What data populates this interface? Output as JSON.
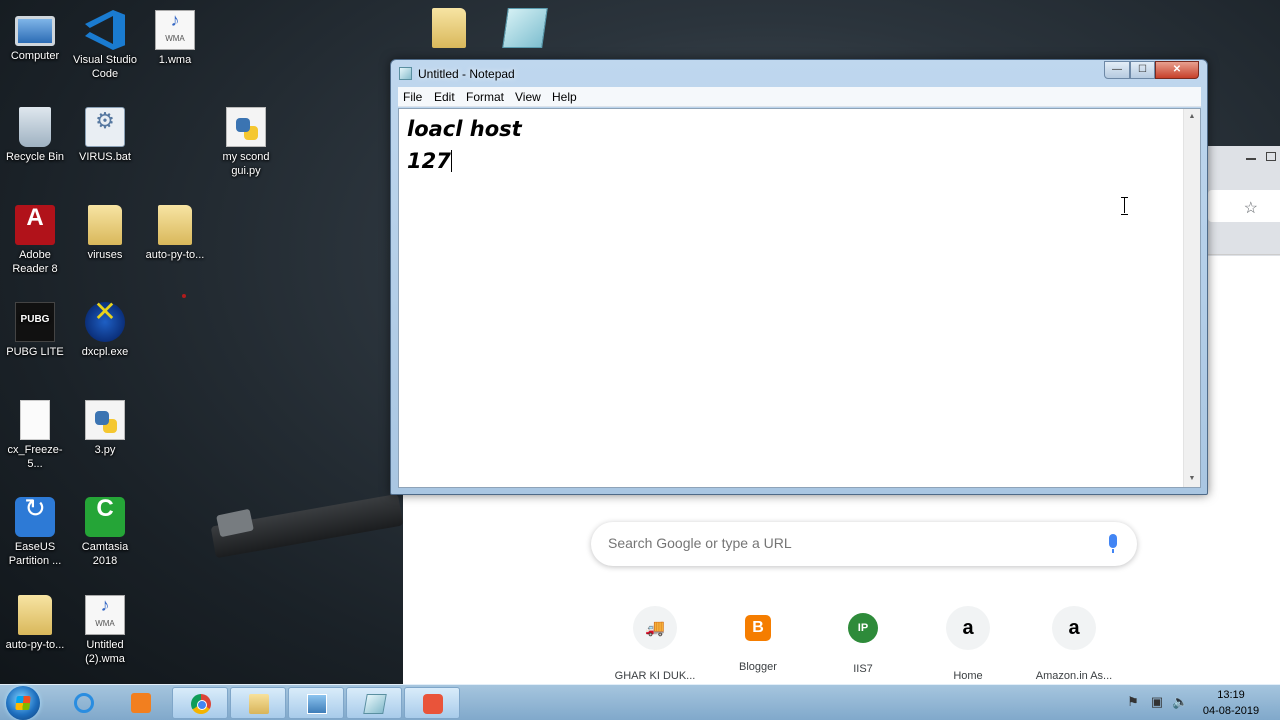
{
  "desktop": {
    "icons": [
      {
        "label": "Computer",
        "icon": "computer-icon"
      },
      {
        "label": "Visual Studio Code",
        "icon": "vscode-icon"
      },
      {
        "label": "1.wma",
        "icon": "wma-file-icon"
      },
      {
        "label": "Recycle Bin",
        "icon": "recycle-bin-icon"
      },
      {
        "label": "VIRUS.bat",
        "icon": "bat-file-icon"
      },
      {
        "label": "my scond gui.py",
        "icon": "python-file-icon"
      },
      {
        "label": "Adobe Reader 8",
        "icon": "adobe-reader-icon"
      },
      {
        "label": "viruses",
        "icon": "folder-icon"
      },
      {
        "label": "auto-py-to...",
        "icon": "folder-icon"
      },
      {
        "label": "PUBG LITE",
        "icon": "pubg-icon"
      },
      {
        "label": "dxcpl.exe",
        "icon": "dxcpl-icon"
      },
      {
        "label": "cx_Freeze-5...",
        "icon": "blank-file-icon"
      },
      {
        "label": "3.py",
        "icon": "python-file-icon"
      },
      {
        "label": "EaseUS Partition ...",
        "icon": "easeus-icon"
      },
      {
        "label": "Camtasia 2018",
        "icon": "camtasia-icon"
      },
      {
        "label": "auto-py-to...",
        "icon": "zip-folder-icon"
      },
      {
        "label": "Untitled (2).wma",
        "icon": "wma-file-icon"
      }
    ]
  },
  "notepad": {
    "title": "Untitled - Notepad",
    "menu": [
      "File",
      "Edit",
      "Format",
      "View",
      "Help"
    ],
    "lines": [
      "loacl host",
      "127"
    ],
    "buttons": {
      "minimize": "—",
      "maximize": "☐",
      "close": "✕"
    }
  },
  "chrome": {
    "search_placeholder": "Search Google or type a URL",
    "shortcuts": [
      {
        "label": "GHAR KI DUK...",
        "glyph": "🚚",
        "color": "#d93025"
      },
      {
        "label": "Blogger",
        "glyph": "B",
        "color": "#f57d00"
      },
      {
        "label": "IIS7",
        "glyph": "IP",
        "color": "#2e8b3a"
      },
      {
        "label": "Home",
        "glyph": "a",
        "color": "#000000"
      },
      {
        "label": "Amazon.in As...",
        "glyph": "a",
        "color": "#000000"
      }
    ]
  },
  "taskbar": {
    "apps": [
      {
        "name": "internet-explorer",
        "icon": "ie-icon"
      },
      {
        "name": "media-player",
        "icon": "media-player-icon"
      },
      {
        "name": "chrome",
        "icon": "chrome-icon"
      },
      {
        "name": "file-explorer",
        "icon": "folder-icon"
      },
      {
        "name": "remote-desktop",
        "icon": "remote-desktop-icon"
      },
      {
        "name": "notepad",
        "icon": "notepad-icon"
      },
      {
        "name": "camtasia",
        "icon": "camtasia-icon"
      }
    ],
    "time": "13:19",
    "date": "04-08-2019"
  }
}
